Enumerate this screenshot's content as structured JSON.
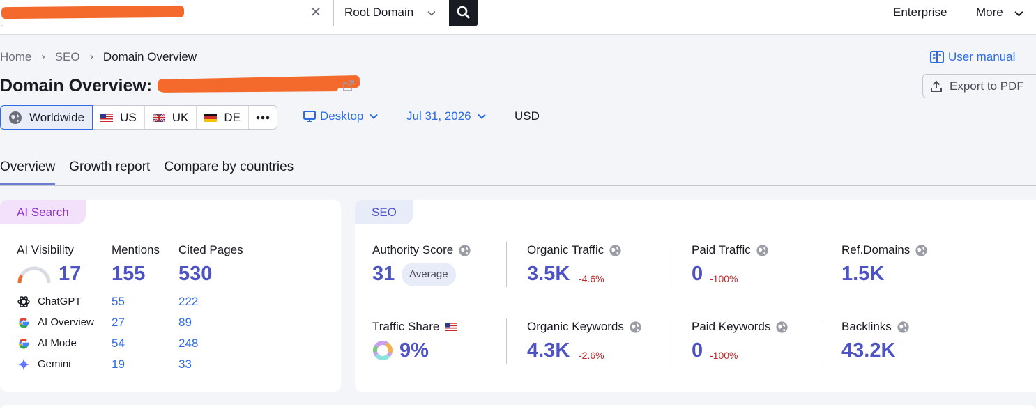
{
  "topbar": {
    "clear_icon": "close-icon",
    "scope": "Root Domain",
    "links": [
      "Enterprise",
      "More"
    ]
  },
  "breadcrumb": [
    "Home",
    "SEO",
    "Domain Overview"
  ],
  "user_manual": "User manual",
  "page_title": "Domain Overview:",
  "export_label": "Export to PDF",
  "databases": [
    {
      "label": "Worldwide",
      "icon": "globe-icon",
      "active": true
    },
    {
      "label": "US",
      "icon": "flag-us-icon"
    },
    {
      "label": "UK",
      "icon": "flag-uk-icon"
    },
    {
      "label": "DE",
      "icon": "flag-de-icon"
    }
  ],
  "device": "Desktop",
  "date": "Jul 31, 2026",
  "currency": "USD",
  "tabs": [
    "Overview",
    "Growth report",
    "Compare by countries"
  ],
  "ai_card": {
    "tag": "AI Search",
    "headers": [
      "AI Visibility",
      "Mentions",
      "Cited Pages"
    ],
    "visibility": "17",
    "visibility_fraction": 0.17,
    "mentions": "155",
    "cited": "530",
    "rows": [
      {
        "label": "ChatGPT",
        "mentions": "55",
        "cited": "222",
        "icon": "chatgpt-icon"
      },
      {
        "label": "AI Overview",
        "mentions": "27",
        "cited": "89",
        "icon": "google-icon"
      },
      {
        "label": "AI Mode",
        "mentions": "54",
        "cited": "248",
        "icon": "google-icon"
      },
      {
        "label": "Gemini",
        "mentions": "19",
        "cited": "33",
        "icon": "gemini-icon"
      }
    ]
  },
  "seo_card": {
    "tag": "SEO",
    "authority": {
      "label": "Authority Score",
      "value": "31",
      "badge": "Average"
    },
    "organic_traffic": {
      "label": "Organic Traffic",
      "value": "3.5K",
      "delta": "-4.6%"
    },
    "paid_traffic": {
      "label": "Paid Traffic",
      "value": "0",
      "delta": "-100%"
    },
    "ref_domains": {
      "label": "Ref.Domains",
      "value": "1.5K"
    },
    "traffic_share": {
      "label": "Traffic Share",
      "value": "9%"
    },
    "organic_keywords": {
      "label": "Organic Keywords",
      "value": "4.3K",
      "delta": "-2.6%"
    },
    "paid_keywords": {
      "label": "Paid Keywords",
      "value": "0",
      "delta": "-100%"
    },
    "backlinks": {
      "label": "Backlinks",
      "value": "43.2K"
    }
  },
  "colors": {
    "accent": "#4d53c4",
    "link": "#2d6be6",
    "negative": "#c62828",
    "brand_orange": "#f46a2c"
  }
}
